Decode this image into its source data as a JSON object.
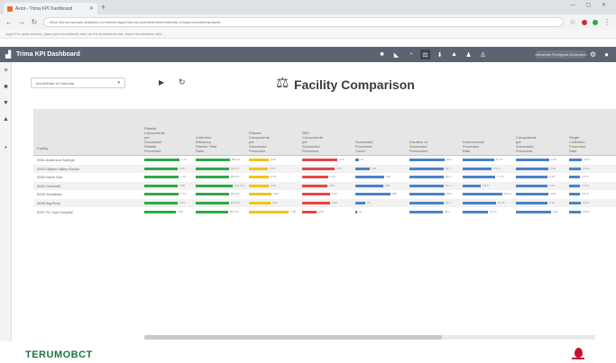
{
  "browser": {
    "tab_title": "Aviot - Trima KPI Dashboard",
    "url": "https://trima.example-analytics.com/sense/app/trima-kpi-dashboard/sheet/facility-comparison/state/analysis",
    "bookmarks": "Apps  For quick access, place your bookmarks here on the bookmarks bar. Import bookmarks now..."
  },
  "app": {
    "title": "Trima KPI Dashboard",
    "user_label": "Alexander Rodriguez Andersson"
  },
  "controls": {
    "period_select": "Month/Date of Calendar"
  },
  "page": {
    "title": "Facility Comparison"
  },
  "table": {
    "headers": [
      "Facility",
      "Platelet\nComponents\nper\nSuccessful\nPlatelet\nProcedure",
      "Collection\nEfficiency\nPlatelet Yield\nRatio",
      "Plasma\nComponents\nper\nSuccessful\nProcedure",
      "RBC\nComponents\nper\nSuccessful\nProcedure",
      "Successful\nProcedure\nCount",
      "Duration of\nSuccessful\nProcedures",
      "Unsuccessful\nProcedure\nRate",
      "Components\nper\nSuccessful\nProcedure",
      "Single\nCollection\nProcedure\nRate"
    ],
    "rows": [
      {
        "facility": "0001 Anderson Springs",
        "values": [
          "1.74",
          "88.9 %",
          "0.82",
          "2.16",
          "12",
          "54.5",
          "6.7 %",
          "2.43",
          "4.8 %"
        ]
      },
      {
        "facility": "0002 Hidden Valley Ranch",
        "values": [
          "1.65",
          "86.2 %",
          "0.78",
          "1.87",
          "148",
          "51.3",
          "5.9 %",
          "2.28",
          "3.9 %"
        ]
      },
      {
        "facility": "0003 North Star",
        "values": [
          "1.70",
          "86.9 %",
          "0.79",
          "1.54",
          "230",
          "52.6",
          "7.1 %",
          "2.18",
          "3.2 %"
        ]
      },
      {
        "facility": "0004 Greenhill",
        "values": [
          "1.68",
          "101.3 %",
          "0.84",
          "1.50",
          "226",
          "51.2",
          "3.9 %",
          "2.20",
          "3.4 %"
        ]
      },
      {
        "facility": "0005 Woodlake",
        "values": [
          "1.72",
          "86.8 %",
          "0.91",
          "1.62",
          "290",
          "53.9",
          "9.8 %",
          "2.25",
          "3.5 %"
        ]
      },
      {
        "facility": "0006 Big Rock",
        "values": [
          "1.64",
          "87.9 %",
          "0.87",
          "1.63",
          "75",
          "52.7",
          "8.2 %",
          "2.19",
          "3.6 %"
        ]
      },
      {
        "facility": "0007 St. Cyril Hospital",
        "values": [
          "1.55",
          "85.6 %",
          "1.48",
          "0.83",
          "44",
          "50.1",
          "5.3 %",
          "2.46",
          "3.8 %"
        ]
      }
    ],
    "bar_fractions": [
      [
        0.84,
        0.82,
        0.48,
        0.86,
        0.08,
        0.84,
        0.76,
        0.8,
        0.3
      ],
      [
        0.8,
        0.8,
        0.46,
        0.78,
        0.34,
        0.82,
        0.7,
        0.78,
        0.28
      ],
      [
        0.82,
        0.8,
        0.47,
        0.64,
        0.7,
        0.83,
        0.78,
        0.76,
        0.26
      ],
      [
        0.81,
        0.9,
        0.48,
        0.62,
        0.68,
        0.82,
        0.44,
        0.77,
        0.27
      ],
      [
        0.83,
        0.8,
        0.54,
        0.68,
        0.86,
        0.84,
        0.96,
        0.79,
        0.27
      ],
      [
        0.8,
        0.81,
        0.52,
        0.68,
        0.24,
        0.83,
        0.8,
        0.77,
        0.28
      ],
      [
        0.76,
        0.79,
        0.96,
        0.34,
        0.04,
        0.8,
        0.62,
        0.86,
        0.29
      ]
    ],
    "bar_colors": [
      "#2fa846",
      "#2fa846",
      "#f0c419",
      "#e84545",
      "#4a83c6",
      "#4a83c6",
      "#4a83c6",
      "#4a83c6",
      "#4a83c6"
    ],
    "row_colors": [
      [
        "#2fa846",
        "#2fa846",
        "#f0c419",
        "#e84545"
      ],
      [
        "#2fa846",
        "#2fa846",
        "#f0c419",
        "#e84545"
      ],
      [
        "#2fa846",
        "#2fa846",
        "#f0c419",
        "#e84545"
      ],
      [
        "#2fa846",
        "#2fa846",
        "#f0c419",
        "#e84545"
      ],
      [
        "#2fa846",
        "#2fa846",
        "#f0c419",
        "#e84545"
      ],
      [
        "#2fa846",
        "#2fa846",
        "#f0c419",
        "#e84545"
      ],
      [
        "#2fa846",
        "#2fa846",
        "#f0c419",
        "#e84545"
      ]
    ]
  },
  "footer": {
    "brand": "TERUMOBCT"
  },
  "icons": {
    "app_logo": "dashboard-logo-icon",
    "page": "scales-icon",
    "brand_mark": "blood-drop-icon"
  }
}
